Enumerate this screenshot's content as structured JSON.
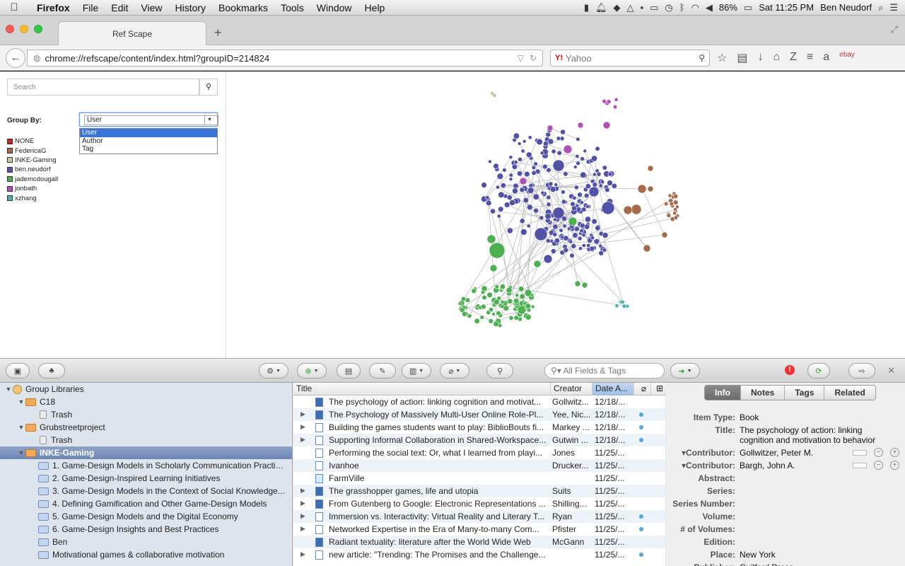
{
  "menubar": {
    "app": "Firefox",
    "items": [
      "File",
      "Edit",
      "View",
      "History",
      "Bookmarks",
      "Tools",
      "Window",
      "Help"
    ],
    "battery": "86%",
    "clock": "Sat 11:25 PM",
    "user": "Ben Neudorf"
  },
  "browser": {
    "tab_title": "Ref Scape",
    "url": "chrome://refscape/content/index.html?groupID=214824",
    "search_placeholder": "Yahoo",
    "search_engine_label": "Y!"
  },
  "refscape": {
    "search_placeholder": "Search",
    "groupby_label": "Group By:",
    "groupby_value": "User",
    "groupby_options": [
      "User",
      "Author",
      "Tag"
    ],
    "legend": [
      {
        "label": "NONE",
        "color": "#cc2222"
      },
      {
        "label": "FedericaG",
        "color": "#a46a4a"
      },
      {
        "label": "INKE-Gaming",
        "color": "#c8c8a0"
      },
      {
        "label": "ben.neudorf",
        "color": "#5151a8"
      },
      {
        "label": "jademcdougall",
        "color": "#4caf50"
      },
      {
        "label": "jonbath",
        "color": "#b150b4"
      },
      {
        "label": "xzhang",
        "color": "#4ab0b0"
      }
    ]
  },
  "zotero": {
    "search_placeholder": "All Fields & Tags",
    "collections": [
      {
        "label": "Group Libraries",
        "depth": 0,
        "twisty": "▼",
        "icon": "group"
      },
      {
        "label": "C18",
        "depth": 1,
        "twisty": "▼",
        "icon": "orange"
      },
      {
        "label": "Trash",
        "depth": 2,
        "twisty": "",
        "icon": "trash"
      },
      {
        "label": "Grubstreetproject",
        "depth": 1,
        "twisty": "▼",
        "icon": "orange"
      },
      {
        "label": "Trash",
        "depth": 2,
        "twisty": "",
        "icon": "trash"
      },
      {
        "label": "INKE-Gaming",
        "depth": 1,
        "twisty": "▼",
        "icon": "orange",
        "selected": true
      },
      {
        "label": "1. Game-Design Models in Scholarly Communication Practic...",
        "depth": 2,
        "twisty": "",
        "icon": "folder"
      },
      {
        "label": "2. Game-Design-Inspired Learning Initiatives",
        "depth": 2,
        "twisty": "",
        "icon": "folder"
      },
      {
        "label": "3. Game-Design Models in the Context of Social Knowledge...",
        "depth": 2,
        "twisty": "",
        "icon": "folder"
      },
      {
        "label": "4. Defining Gamification and Other Game-Design Models",
        "depth": 2,
        "twisty": "",
        "icon": "folder"
      },
      {
        "label": "5. Game-Design Models and the Digital Economy",
        "depth": 2,
        "twisty": "",
        "icon": "folder"
      },
      {
        "label": "6. Game-Design Insights and Best Practices",
        "depth": 2,
        "twisty": "",
        "icon": "folder"
      },
      {
        "label": "Ben",
        "depth": 2,
        "twisty": "",
        "icon": "folder"
      },
      {
        "label": "Motivational games & collaborative motivation",
        "depth": 2,
        "twisty": "",
        "icon": "folder"
      }
    ],
    "columns": {
      "title": "Title",
      "creator": "Creator",
      "date": "Date A..."
    },
    "items": [
      {
        "title": "The psychology of action: linking cognition and motivat...",
        "creator": "Gollwitz...",
        "date": "12/18/...",
        "twisty": false,
        "icon": "book",
        "attachment": false
      },
      {
        "title": "The Psychology of Massively Multi-User Online  Role-Pl...",
        "creator": "Yee, Nic...",
        "date": "12/18/...",
        "twisty": true,
        "icon": "bookopen",
        "attachment": true
      },
      {
        "title": "Building the games students want to play: BiblioBouts fi...",
        "creator": "Markey ...",
        "date": "12/18/...",
        "twisty": true,
        "icon": "doc",
        "attachment": true
      },
      {
        "title": "Supporting Informal Collaboration in Shared-Workspace...",
        "creator": "Gutwin ...",
        "date": "12/18/...",
        "twisty": true,
        "icon": "doc",
        "attachment": true
      },
      {
        "title": "Performing the social text: Or, what I learned from playi...",
        "creator": "Jones",
        "date": "11/25/...",
        "twisty": false,
        "icon": "doc",
        "attachment": false
      },
      {
        "title": "Ivanhoe",
        "creator": "Drucker...",
        "date": "11/25/...",
        "twisty": false,
        "icon": "doc",
        "attachment": false
      },
      {
        "title": "FarmVille",
        "creator": "",
        "date": "11/25/...",
        "twisty": false,
        "icon": "web",
        "attachment": false
      },
      {
        "title": "The grasshopper games, life and utopia",
        "creator": "Suits",
        "date": "11/25/...",
        "twisty": true,
        "icon": "book",
        "attachment": false
      },
      {
        "title": "From Gutenberg to Google: Electronic Representations ...",
        "creator": "Shilling...",
        "date": "11/25/...",
        "twisty": true,
        "icon": "book",
        "attachment": false
      },
      {
        "title": "Immersion vs. Interactivity: Virtual Reality and Literary T...",
        "creator": "Ryan",
        "date": "11/25/...",
        "twisty": true,
        "icon": "doc",
        "attachment": true
      },
      {
        "title": "Networked Expertise in the Era of Many-to-many Com...",
        "creator": "Pfister",
        "date": "11/25/...",
        "twisty": true,
        "icon": "doc",
        "attachment": true
      },
      {
        "title": "Radiant textuality: literature after the World Wide Web",
        "creator": "McGann",
        "date": "11/25/...",
        "twisty": false,
        "icon": "book",
        "attachment": false
      },
      {
        "title": "new article: \"Trending: The Promises and the Challenge...",
        "creator": "",
        "date": "11/25/...",
        "twisty": true,
        "icon": "doc",
        "attachment": true
      }
    ],
    "info_tabs": [
      "Info",
      "Notes",
      "Tags",
      "Related"
    ],
    "info_fields": [
      {
        "label": "Item Type:",
        "value": "Book"
      },
      {
        "label": "Title:",
        "value": "The psychology of action: linking cognition and motivation to behavior"
      },
      {
        "label": "▾Contributor:",
        "value": "Gollwitzer, Peter M.",
        "contributor": true
      },
      {
        "label": "▾Contributor:",
        "value": "Bargh, John A.",
        "contributor": true
      },
      {
        "label": "Abstract:",
        "value": ""
      },
      {
        "label": "Series:",
        "value": ""
      },
      {
        "label": "Series Number:",
        "value": ""
      },
      {
        "label": "Volume:",
        "value": ""
      },
      {
        "label": "# of Volumes:",
        "value": ""
      },
      {
        "label": "Edition:",
        "value": ""
      },
      {
        "label": "Place:",
        "value": "New York"
      },
      {
        "label": "Publisher:",
        "value": "Guilford Press"
      }
    ]
  }
}
